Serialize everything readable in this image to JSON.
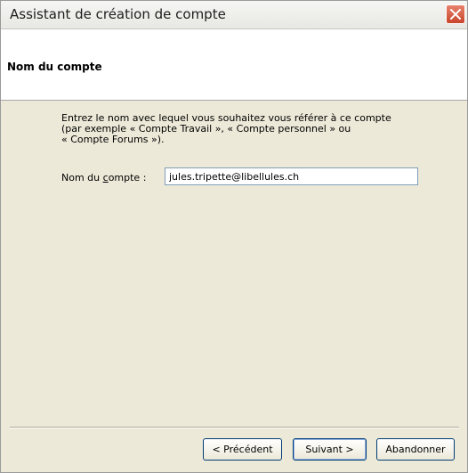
{
  "window": {
    "title": "Assistant de création de compte"
  },
  "header": {
    "title": "Nom du compte"
  },
  "content": {
    "description_lines": [
      "Entrez le nom avec lequel vous souhaitez vous référer à ce compte",
      "(par exemple « Compte Travail », « Compte personnel » ou",
      "« Compte Forums »)."
    ],
    "field": {
      "label_before": "Nom du ",
      "label_accel": "c",
      "label_after": "ompte :",
      "value": "jules.tripette@libellules.ch"
    }
  },
  "footer": {
    "prev_label": "< Précédent",
    "next_label": "Suivant >",
    "cancel_label": "Abandonner"
  }
}
